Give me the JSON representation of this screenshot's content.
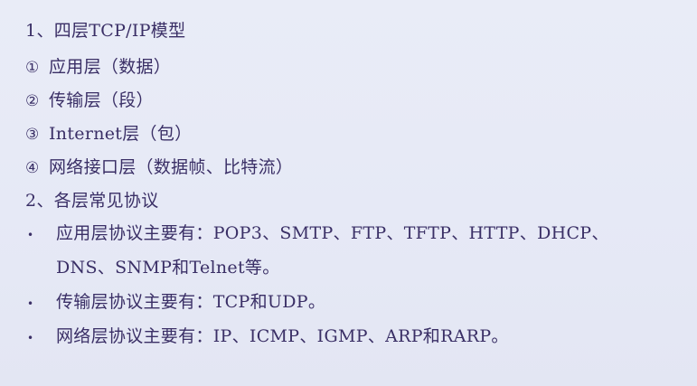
{
  "lines": {
    "heading1": "1、四层TCP/IP模型",
    "item1_marker": "①",
    "item1_text": "应用层（数据）",
    "item2_marker": "②",
    "item2_text": "传输层（段）",
    "item3_marker": "③",
    "item3_text": "Internet层（包）",
    "item4_marker": "④",
    "item4_text": "网络接口层（数据帧、比特流）",
    "heading2": "2、各层常见协议"
  },
  "bullets": [
    {
      "marker": "•",
      "line1": "应用层协议主要有：POP3、SMTP、FTP、TFTP、HTTP、DHCP、",
      "line2": "DNS、SNMP和Telnet等。"
    },
    {
      "marker": "•",
      "line1": "传输层协议主要有：TCP和UDP。"
    },
    {
      "marker": "•",
      "line1": "网络层协议主要有：IP、ICMP、IGMP、ARP和RARP。"
    }
  ]
}
